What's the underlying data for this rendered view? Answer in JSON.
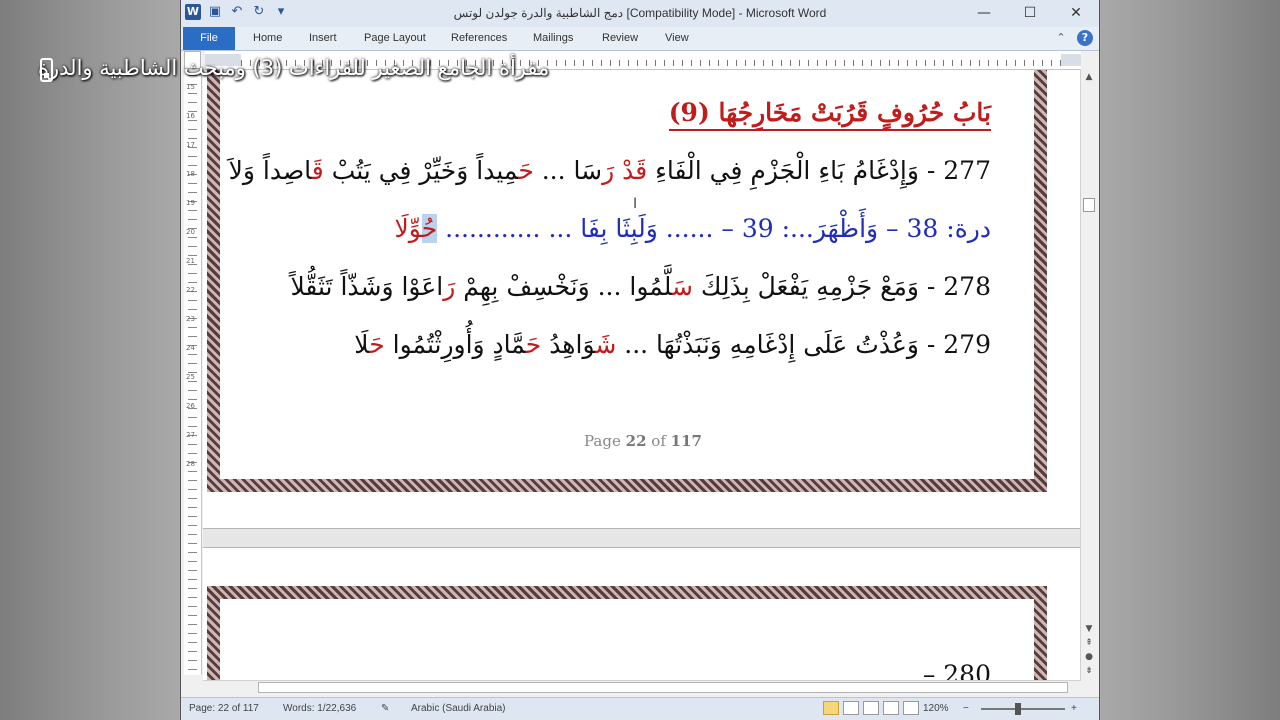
{
  "overlay": {
    "caption": "مقرأة الجامع الصغير للقراءات (3) ومبحث الشاطبية والدرة",
    "icon": "video-icon"
  },
  "window": {
    "title": "دمج الشاطبية والدرة جولدن لوتس [Compatibility Mode]  -  Microsoft Word",
    "controls": {
      "minimize": "—",
      "maximize": "☐",
      "close": "✕"
    },
    "qat_icons": [
      "word-icon",
      "save-icon",
      "undo-icon",
      "redo-icon",
      "customize-icon"
    ]
  },
  "ribbon": {
    "file": "File",
    "tabs": [
      "Home",
      "Insert",
      "Page Layout",
      "References",
      "Mailings",
      "Review",
      "View"
    ],
    "help": "?"
  },
  "document": {
    "chapter_heading": "بَابُ حُرُوفٍ قَرُبَتْ مَخَارِجُهَا (9)",
    "lines": [
      {
        "num": "277",
        "text": "- وَإِدْغَامُ بَاءِ الْجَزْمِ فِي الْفَاءِ",
        "red1": "قَدْ رَ",
        "mid": "سَا ...",
        "red2": "حَ",
        "tail": "مِيداً وَخَيِّرْ فِي يَتُبْ",
        "red3": "قَ",
        "end": "اصِداً وَلاَ"
      },
      {
        "prefix": "درة:",
        "a": "38 – وَأَظْهَرَ...: 39 –",
        "b": "...... وَلَبِثَا بِفَا ... ............",
        "hl": "حُ",
        "end": "وِّلَا"
      },
      {
        "num": "278",
        "text": "- وَمَعْ جَزْمِهِ يَفْعَلْ بِذَلِكَ",
        "red1": "سَ",
        "mid": "لَّمُوا ... وَنَخْسِفْ بِهِمْ",
        "red2": "رَ",
        "tail": "اعَوْا وَشَذّاً تَثَقُّلاً"
      },
      {
        "num": "279",
        "text": "- وَعُذْتُ عَلَى إِدْغَامِهِ وَنَبَذْتُهَا ...",
        "red1": "شَ",
        "mid": "وَاهِدُ",
        "red2": "حَ",
        "tail": "مَّادٍ وَأُورِثْتُمُوا",
        "red3": "حَ",
        "end": "لَا"
      }
    ],
    "page_label": "Page",
    "page_current": "22",
    "page_of": "of",
    "page_total": "117",
    "next_page_line": "280 –"
  },
  "status": {
    "page": "Page: 22 of 117",
    "words": "Words: 1/22,636",
    "language": "Arabic (Saudi Arabia)",
    "zoom": "120%",
    "zoom_minus": "−",
    "zoom_plus": "+"
  },
  "vruler_numbers": [
    "15",
    "16",
    "17",
    "18",
    "19",
    "20",
    "21",
    "22",
    "23",
    "24",
    "25",
    "26",
    "27",
    "28"
  ]
}
